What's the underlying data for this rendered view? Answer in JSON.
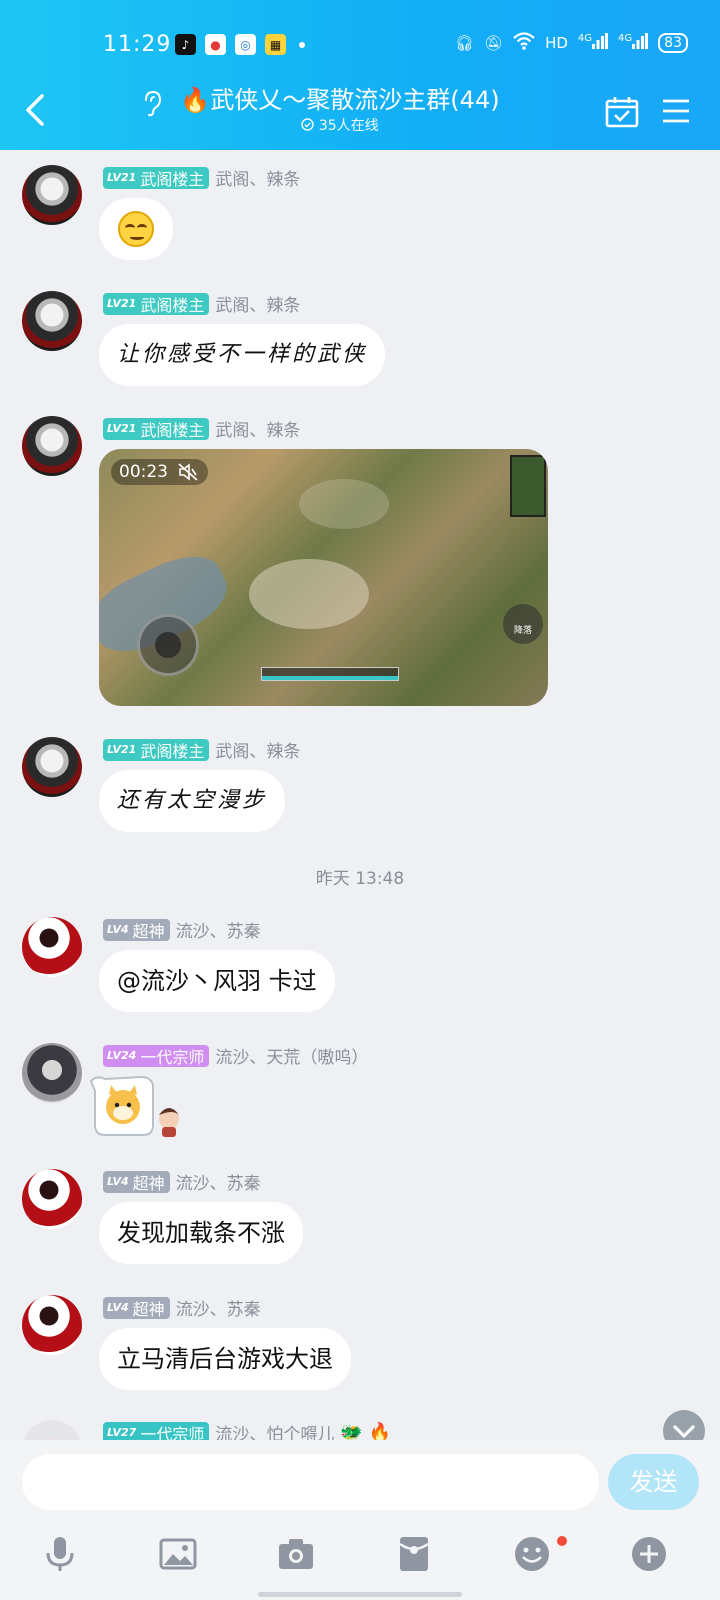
{
  "status_bar": {
    "time": "11:29",
    "network": "HD",
    "signal_1": "4G",
    "signal_2": "4G",
    "battery": "83"
  },
  "header": {
    "title": "武侠乂～聚散流沙主群(44)",
    "online": "35人在线"
  },
  "messages": [
    {
      "sender": "武阁、辣条",
      "badge_level": "LV21",
      "badge_title": "武阁楼主",
      "type": "emoji",
      "emoji_name": "smirk-emoji"
    },
    {
      "sender": "武阁、辣条",
      "badge_level": "LV21",
      "badge_title": "武阁楼主",
      "type": "text",
      "text": "让你感受不一样的武侠"
    },
    {
      "sender": "武阁、辣条",
      "badge_level": "LV21",
      "badge_title": "武阁楼主",
      "type": "video",
      "duration": "00:23",
      "skill_label": "降落"
    },
    {
      "sender": "武阁、辣条",
      "badge_level": "LV21",
      "badge_title": "武阁楼主",
      "type": "text",
      "text": "还有太空漫步"
    },
    {
      "type": "timestamp",
      "text": "昨天 13:48"
    },
    {
      "sender": "流沙、苏秦",
      "badge_level": "LV4",
      "badge_title": "超神",
      "type": "text",
      "text": "@流沙丶风羽 卡过"
    },
    {
      "sender": "流沙、天荒（嗷呜）",
      "badge_level": "LV24",
      "badge_title": "一代宗师",
      "type": "sticker",
      "sticker_name": "cat-sticker"
    },
    {
      "sender": "流沙、苏秦",
      "badge_level": "LV4",
      "badge_title": "超神",
      "type": "text",
      "text": "发现加载条不涨"
    },
    {
      "sender": "流沙、苏秦",
      "badge_level": "LV4",
      "badge_title": "超神",
      "type": "text",
      "text": "立马清后台游戏大退"
    },
    {
      "sender": "流沙、怕个嘚儿",
      "badge_level": "LV27",
      "badge_title": "一代宗师",
      "type": "partial"
    }
  ],
  "input": {
    "placeholder": "",
    "send_label": "发送"
  },
  "toolbar": [
    "mic-icon",
    "image-icon",
    "camera-icon",
    "red-packet-icon",
    "emoji-icon",
    "plus-icon"
  ],
  "colors": {
    "header": "#12aef5",
    "badge_teal": "#3ec9c2",
    "badge_gray": "#a3abba",
    "badge_purple": "#d08ff0",
    "send_disabled": "#b3e5f8"
  }
}
